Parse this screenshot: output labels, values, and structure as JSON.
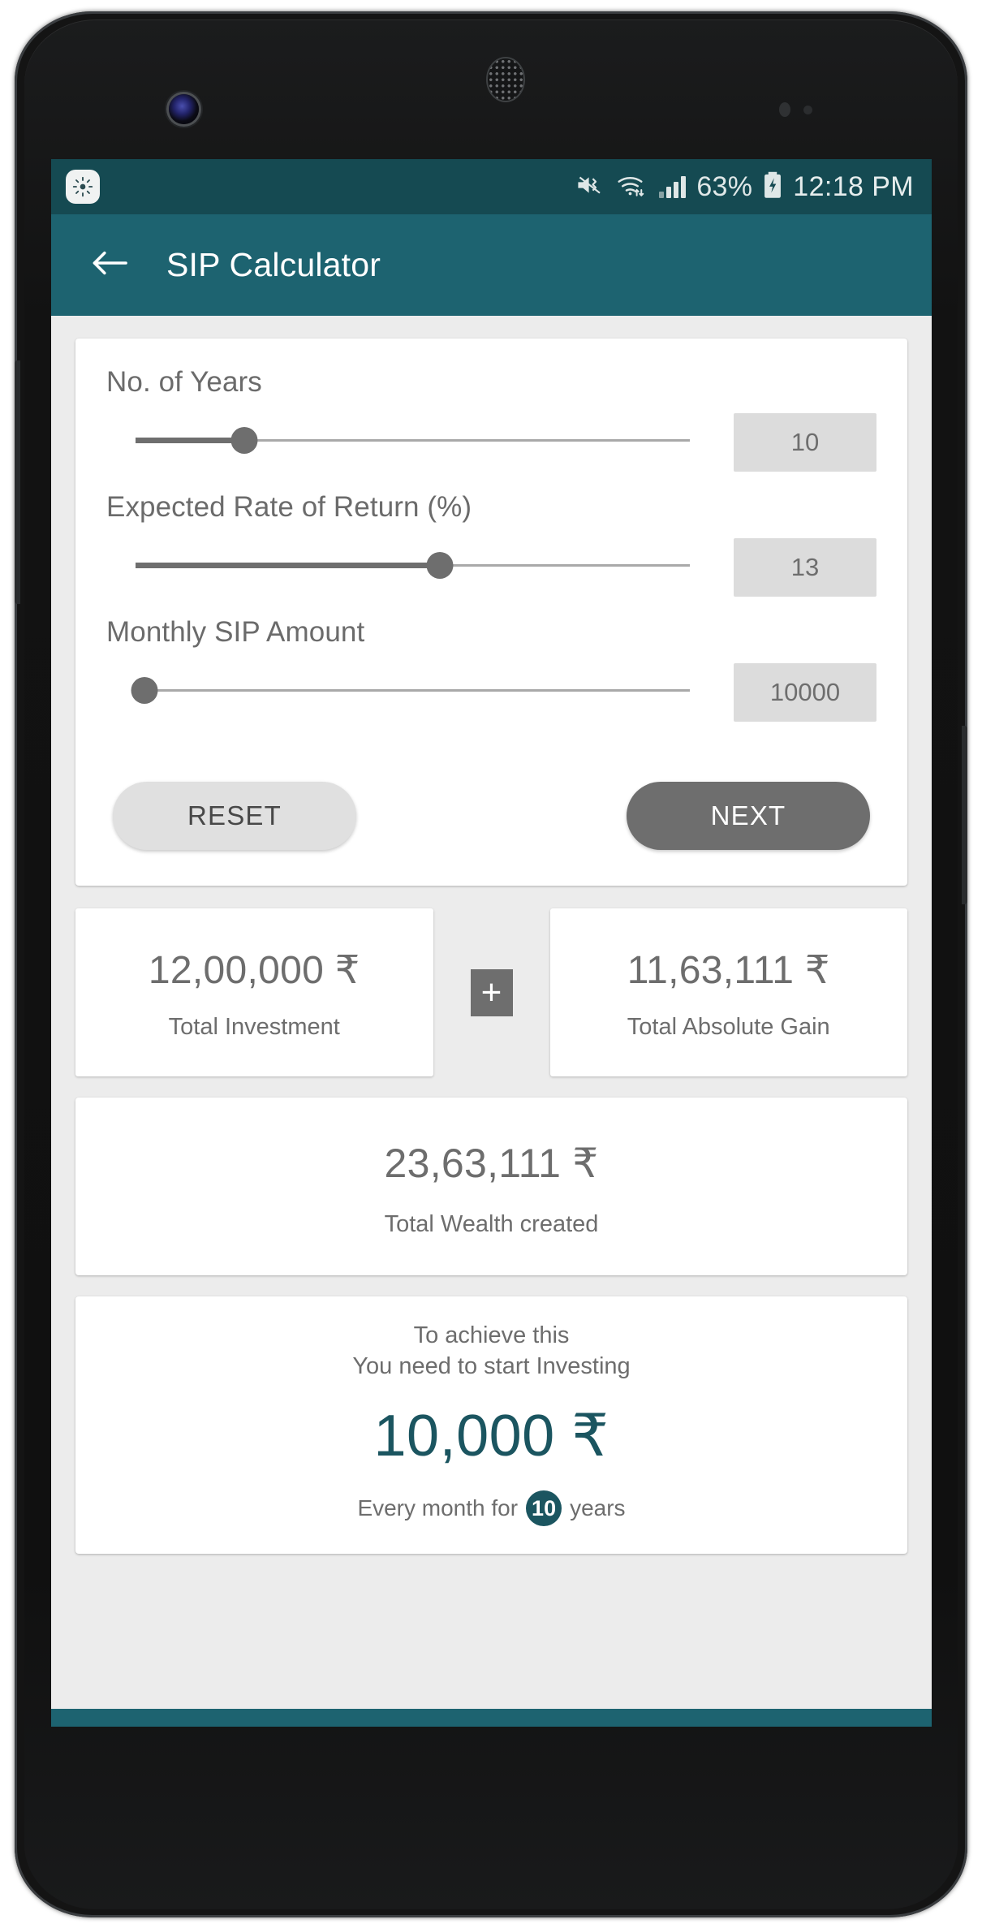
{
  "statusbar": {
    "brightness_icon": "brightness-sun-icon",
    "mute_icon": "volume-mute-icon",
    "wifi_icon": "wifi-transfer-icon",
    "signal_icon": "signal-bars-icon",
    "battery_percent": "63%",
    "battery_icon": "battery-charging-icon",
    "time": "12:18 PM"
  },
  "appbar": {
    "back_icon": "back-arrow-icon",
    "title": "SIP Calculator"
  },
  "inputs": {
    "fields": [
      {
        "label": "No. of Years",
        "value": "10",
        "percent": 19
      },
      {
        "label": "Expected Rate of Return (%)",
        "value": "13",
        "percent": 53
      },
      {
        "label": "Monthly SIP Amount",
        "value": "10000",
        "percent": 2
      }
    ],
    "reset_label": "RESET",
    "next_label": "NEXT"
  },
  "results": {
    "investment": {
      "amount": "12,00,000 ₹",
      "caption": "Total Investment"
    },
    "operator": "+",
    "gain": {
      "amount": "11,63,111 ₹",
      "caption": "Total Absolute Gain"
    },
    "wealth": {
      "amount": "23,63,111 ₹",
      "caption": "Total Wealth created"
    }
  },
  "achieve": {
    "line1": "To achieve this",
    "line2": "You need to start Investing",
    "amount": "10,000 ₹",
    "foot_prefix": "Every month for",
    "years": "10",
    "foot_suffix": "years"
  },
  "colors": {
    "statusbar": "#154a52",
    "appbar": "#1d6370",
    "accent": "#1b5560",
    "background": "#ececec"
  }
}
